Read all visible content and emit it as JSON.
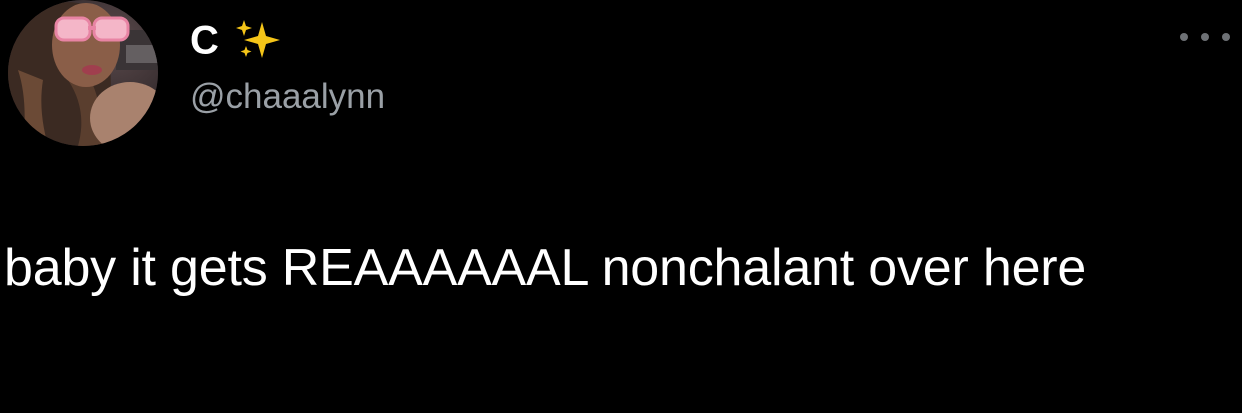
{
  "author": {
    "display_name": "C",
    "name_emoji": "sparkles-emoji",
    "handle": "@chaaalynn",
    "avatar": "profile-photo"
  },
  "actions": {
    "more_icon": "more-horizontal-icon"
  },
  "tweet": {
    "text": "baby it gets REAAAAAAL nonchalant over here"
  },
  "colors": {
    "background": "#000000",
    "text": "#ffffff",
    "handle": "#9aa0a6",
    "sparkle": "#f5c518"
  }
}
